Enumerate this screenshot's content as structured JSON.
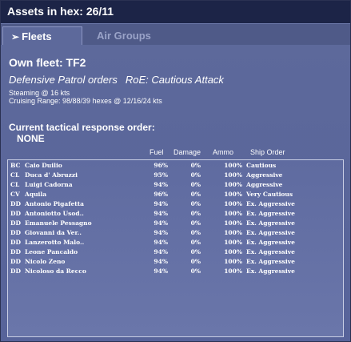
{
  "window": {
    "title": "Assets in hex: 26/11"
  },
  "tabs": [
    {
      "label": "Fleets",
      "active": true,
      "icon": "right-arrow-icon"
    },
    {
      "label": "Air Groups",
      "active": false
    }
  ],
  "fleet": {
    "name": "Own fleet: TF2",
    "orders": "Defensive Patrol orders",
    "roe": "RoE: Cautious Attack",
    "steaming": "Steaming @ 16 kts",
    "cruising_range": "Cruising Range: 98/88/39 hexes @ 12/16/24 kts"
  },
  "tactical": {
    "label": "Current tactical response order:",
    "value": "NONE"
  },
  "columns": {
    "fuel": "Fuel",
    "damage": "Damage",
    "ammo": "Ammo",
    "order": "Ship Order"
  },
  "ships": [
    {
      "type": "BC",
      "name": "Caio Duilio",
      "fuel": "96%",
      "damage": "0%",
      "ammo": "100%",
      "order": "Cautious"
    },
    {
      "type": "CL",
      "name": "Duca d' Abruzzi",
      "fuel": "95%",
      "damage": "0%",
      "ammo": "100%",
      "order": "Aggressive"
    },
    {
      "type": "CL",
      "name": "Luigi Cadorna",
      "fuel": "94%",
      "damage": "0%",
      "ammo": "100%",
      "order": "Aggressive"
    },
    {
      "type": "CV",
      "name": "Aquila",
      "fuel": "96%",
      "damage": "0%",
      "ammo": "100%",
      "order": "Very Cautious"
    },
    {
      "type": "DD",
      "name": "Antonio Pigafetta",
      "fuel": "94%",
      "damage": "0%",
      "ammo": "100%",
      "order": "Ex. Aggressive"
    },
    {
      "type": "DD",
      "name": "Antoniotto Usod..",
      "fuel": "94%",
      "damage": "0%",
      "ammo": "100%",
      "order": "Ex. Aggressive"
    },
    {
      "type": "DD",
      "name": "Emanuele Pessagno",
      "fuel": "94%",
      "damage": "0%",
      "ammo": "100%",
      "order": "Ex. Aggressive"
    },
    {
      "type": "DD",
      "name": "Giovanni da Ver..",
      "fuel": "94%",
      "damage": "0%",
      "ammo": "100%",
      "order": "Ex. Aggressive"
    },
    {
      "type": "DD",
      "name": "Lanzerotto Malo..",
      "fuel": "94%",
      "damage": "0%",
      "ammo": "100%",
      "order": "Ex. Aggressive"
    },
    {
      "type": "DD",
      "name": "Leone Pancaldo",
      "fuel": "94%",
      "damage": "0%",
      "ammo": "100%",
      "order": "Ex. Aggressive"
    },
    {
      "type": "DD",
      "name": "Nicolo Zeno",
      "fuel": "94%",
      "damage": "0%",
      "ammo": "100%",
      "order": "Ex. Aggressive"
    },
    {
      "type": "DD",
      "name": "Nicoloso da Recco",
      "fuel": "94%",
      "damage": "0%",
      "ammo": "100%",
      "order": "Ex. Aggressive"
    }
  ]
}
